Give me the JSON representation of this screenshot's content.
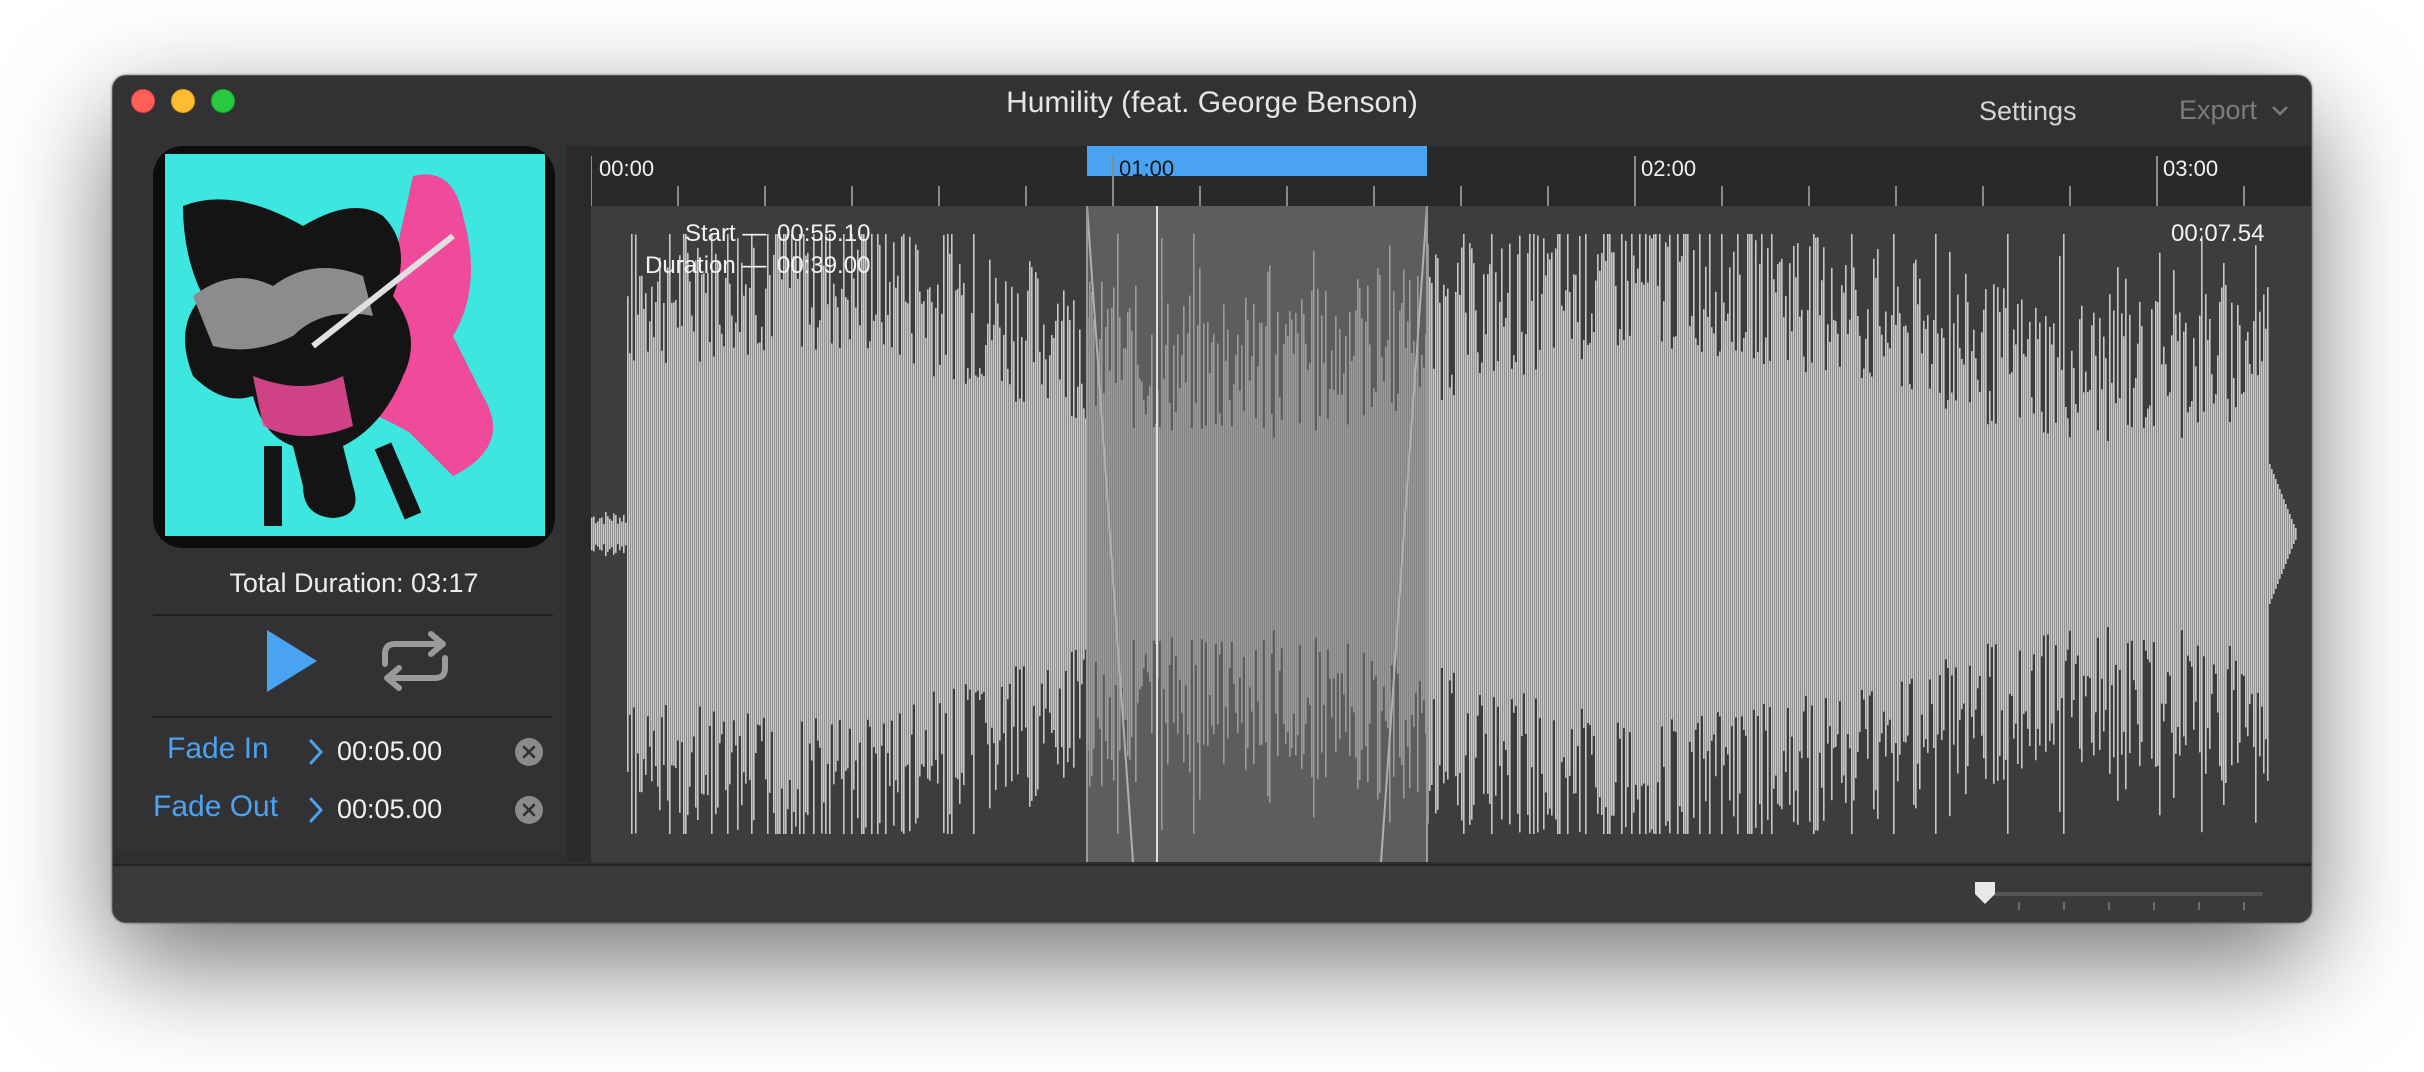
{
  "window": {
    "title": "Humility (feat. George Benson)",
    "settings_label": "Settings",
    "export_label": "Export"
  },
  "sidebar": {
    "total_duration": "Total Duration: 03:17",
    "fade_in": {
      "label": "Fade In",
      "value": "00:05.00"
    },
    "fade_out": {
      "label": "Fade Out",
      "value": "00:05.00"
    }
  },
  "timeline": {
    "markers": [
      "00:00",
      "01:00",
      "02:00",
      "03:00"
    ],
    "selection": {
      "start_label": "Start —",
      "start_value": "00:55.10",
      "duration_label": "Duration —",
      "duration_value": "00:39.00"
    },
    "playhead_time": "00:07.54"
  },
  "colors": {
    "accent": "#4aa3f0",
    "selection": "#4aa3f0",
    "window_bg": "#2f2f31",
    "waveform": "#c8c8c8"
  },
  "icons": {
    "play": "play-icon",
    "loop": "loop-icon",
    "chevron": "chevron-right-icon",
    "clear": "clear-icon"
  }
}
